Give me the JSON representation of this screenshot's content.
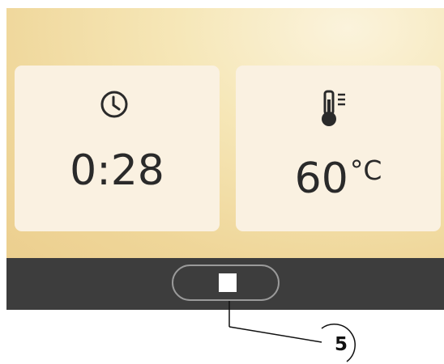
{
  "timer": {
    "icon": "clock-icon",
    "value": "0:28"
  },
  "temperature": {
    "icon": "thermometer-icon",
    "value": "60",
    "unit": "°C"
  },
  "control_bar": {
    "stop_button_icon": "stop-icon"
  },
  "callout": {
    "label": "5"
  },
  "colors": {
    "display_background": "#efd699",
    "card_background": "#faf1e1",
    "text": "#2a2a2a",
    "control_bar": "#3d3d3d",
    "button_outline": "#9a9a9a"
  }
}
